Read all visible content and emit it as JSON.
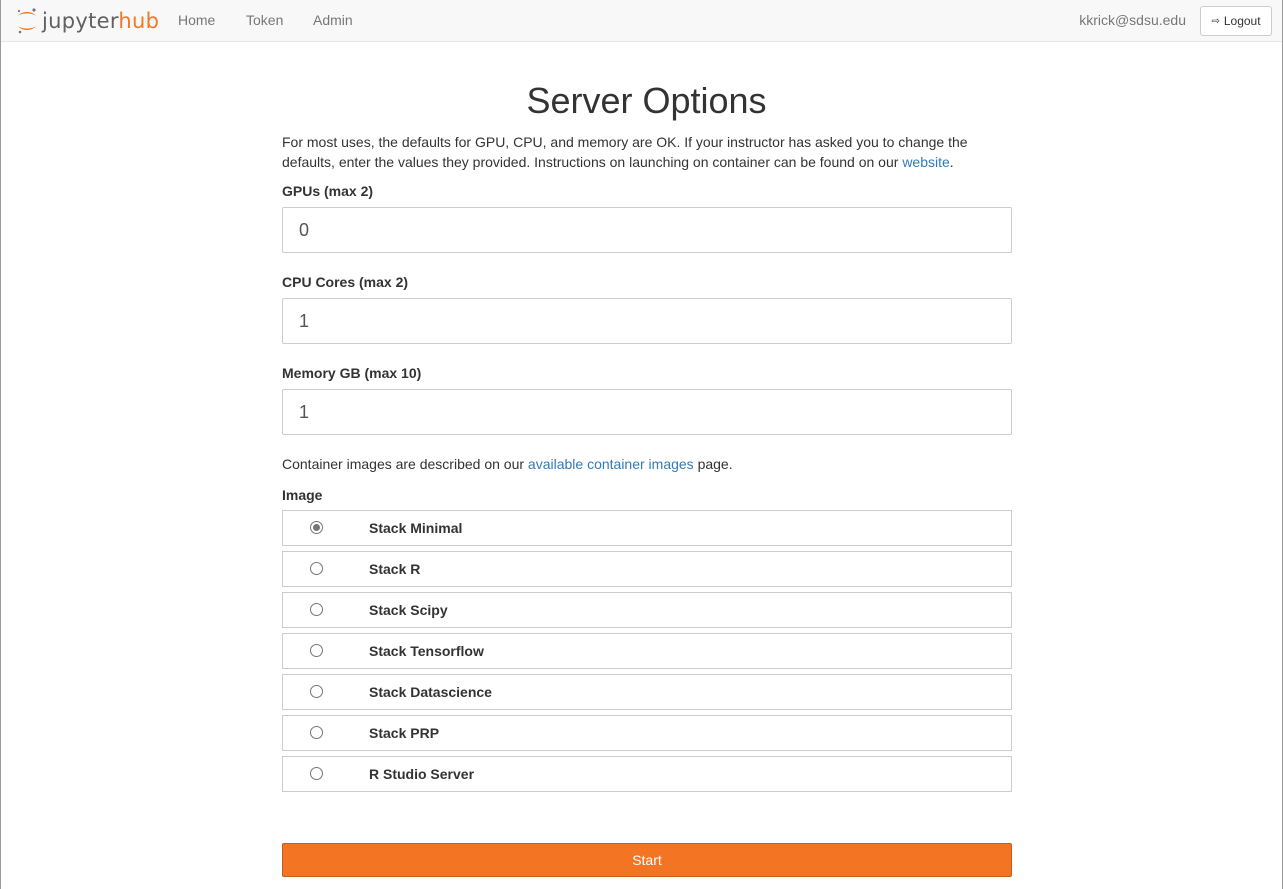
{
  "navbar": {
    "brand": {
      "part1": "jupyter",
      "part2": "hub"
    },
    "links": [
      "Home",
      "Token",
      "Admin"
    ],
    "user": "kkrick@sdsu.edu",
    "logout_label": "Logout"
  },
  "page": {
    "title": "Server Options",
    "intro_text": "For most uses, the defaults for GPU, CPU, and memory are OK. If your instructor has asked you to change the defaults, enter the values they provided. Instructions on launching on container can be found on our ",
    "intro_link": "website",
    "intro_end": "."
  },
  "form": {
    "gpus": {
      "label": "GPUs (max 2)",
      "value": "0"
    },
    "cpu": {
      "label": "CPU Cores (max 2)",
      "value": "1"
    },
    "memory": {
      "label": "Memory GB (max 10)",
      "value": "1"
    },
    "images_desc": {
      "before": "Container images are described on our ",
      "link": "available container images",
      "after": " page."
    },
    "image_label": "Image",
    "images": [
      "Stack Minimal",
      "Stack R",
      "Stack Scipy",
      "Stack Tensorflow",
      "Stack Datascience",
      "Stack PRP",
      "R Studio Server"
    ],
    "selected_image": "Stack Minimal",
    "start_label": "Start"
  },
  "colors": {
    "accent": "#f37524",
    "link": "#337ab7"
  }
}
